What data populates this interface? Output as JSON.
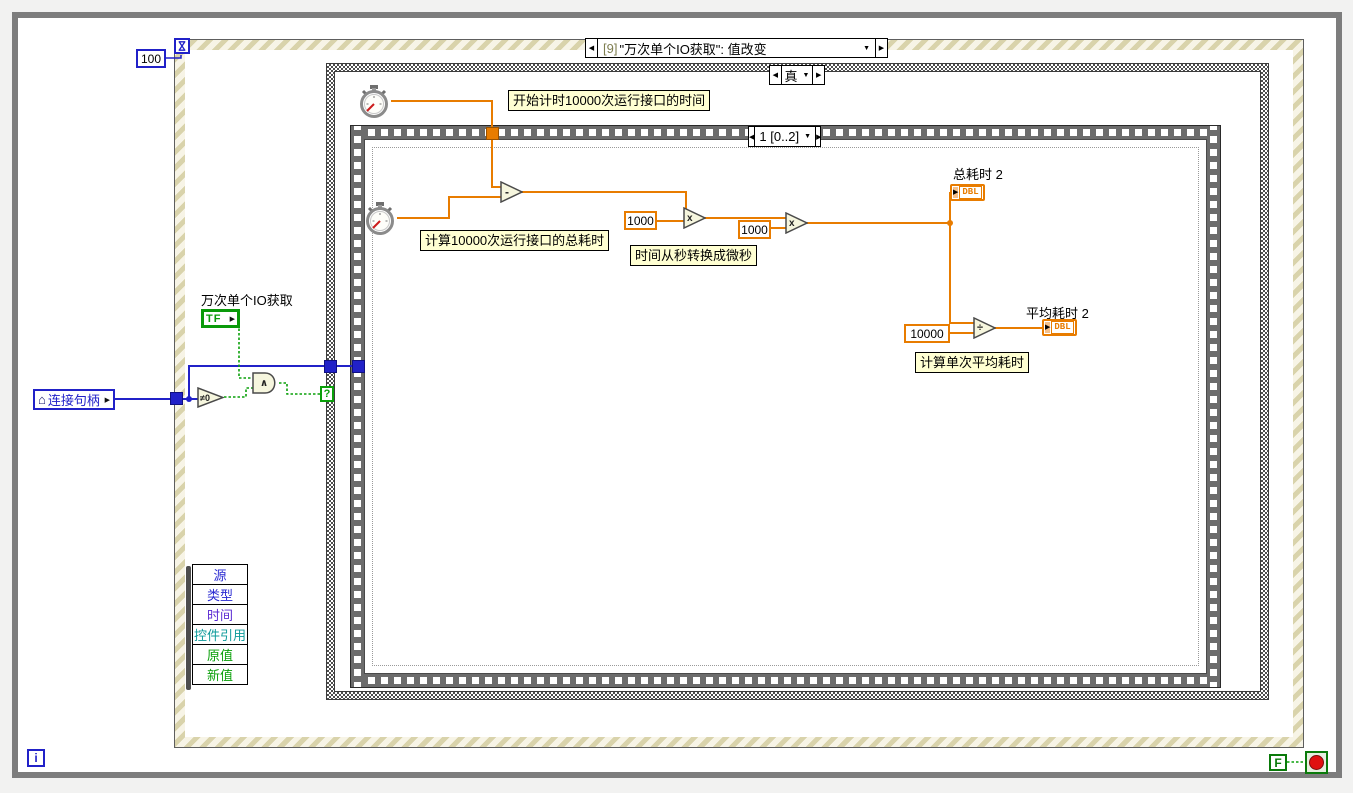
{
  "colors": {
    "numeric_wire": "#e87c00",
    "reference_wire": "#2121c8",
    "boolean_wire": "#0aa00a",
    "comment_bg": "#ffffd2"
  },
  "icons": {
    "prev": "◀",
    "next": "▶",
    "dropdown": "▼",
    "house": "⌂",
    "in_arrow": "▶",
    "out_arrow": "▶"
  },
  "while_loop": {
    "iteration": "i",
    "stop_constant": "F"
  },
  "event_structure": {
    "timeout": "100",
    "selector_index": "[9]",
    "selector_title": "\"万次单个IO获取\": 值改变"
  },
  "case_structure": {
    "selector": "真",
    "condition_terminal": "?"
  },
  "sequence": {
    "selector": "1 [0..2]"
  },
  "comments": {
    "start": "开始计时10000次运行接口的时间",
    "total": "计算10000次运行接口的总耗时",
    "convert": "时间从秒转换成微秒",
    "average": "计算单次平均耗时"
  },
  "constants": {
    "c1000a": "1000",
    "c1000b": "1000",
    "c10000": "10000"
  },
  "controls": {
    "io_bool_label": "万次单个IO获取",
    "io_bool_type": "TF",
    "handle_label": "连接句柄"
  },
  "indicators": {
    "total_label": "总耗时 2",
    "average_label": "平均耗时 2",
    "dbl": "DBL"
  },
  "operators": {
    "subtract": "-",
    "multiply": "x",
    "divide": "÷",
    "and": "∧",
    "neq0": "≠0"
  },
  "event_data_node": {
    "items": [
      {
        "label": "源",
        "color": "#2a2ad2"
      },
      {
        "label": "类型",
        "color": "#2a2ad2"
      },
      {
        "label": "时间",
        "color": "#5b2ad2"
      },
      {
        "label": "控件引用",
        "color": "#0f9b9b"
      },
      {
        "label": "原值",
        "color": "#0aa00a"
      },
      {
        "label": "新值",
        "color": "#0aa00a"
      }
    ]
  }
}
